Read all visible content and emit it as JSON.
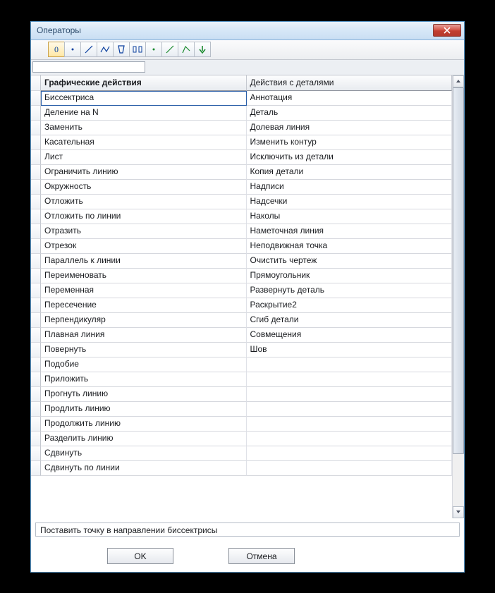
{
  "window": {
    "title": "Операторы"
  },
  "toolbar": {
    "icons": [
      "zero",
      "dot",
      "line",
      "polyline",
      "shape",
      "split",
      "dot2",
      "line2",
      "angle",
      "arrow-down"
    ]
  },
  "columns": [
    {
      "header": "Графические действия",
      "active": true,
      "items": [
        "Биссектриса",
        "Деление на N",
        "Заменить",
        "Касательная",
        "Лист",
        "Ограничить линию",
        "Окружность",
        "Отложить",
        "Отложить по линии",
        "Отразить",
        "Отрезок",
        "Параллель к линии",
        "Переименовать",
        "Переменная",
        "Пересечение",
        "Перпендикуляр",
        "Плавная линия",
        "Повернуть",
        "Подобие",
        "Приложить",
        "Прогнуть линию",
        "Продлить линию",
        "Продолжить линию",
        "Разделить линию",
        "Сдвинуть",
        "Сдвинуть по линии"
      ],
      "selected_index": 0
    },
    {
      "header": "Действия с деталями",
      "active": false,
      "items": [
        "Аннотация",
        "Деталь",
        "Долевая линия",
        "Изменить контур",
        "Исключить из детали",
        "Копия детали",
        "Надписи",
        "Надсечки",
        "Наколы",
        "Наметочная линия",
        "Неподвижная точка",
        "Очистить чертеж",
        "Прямоугольник",
        "Развернуть деталь",
        "Раскрытие2",
        "Сгиб детали",
        "Совмещения",
        "Шов",
        "",
        "",
        "",
        "",
        "",
        "",
        "",
        ""
      ],
      "selected_index": -1
    }
  ],
  "status": {
    "text": "Поставить точку в направлении биссектрисы"
  },
  "buttons": {
    "ok": "OK",
    "cancel": "Отмена"
  }
}
